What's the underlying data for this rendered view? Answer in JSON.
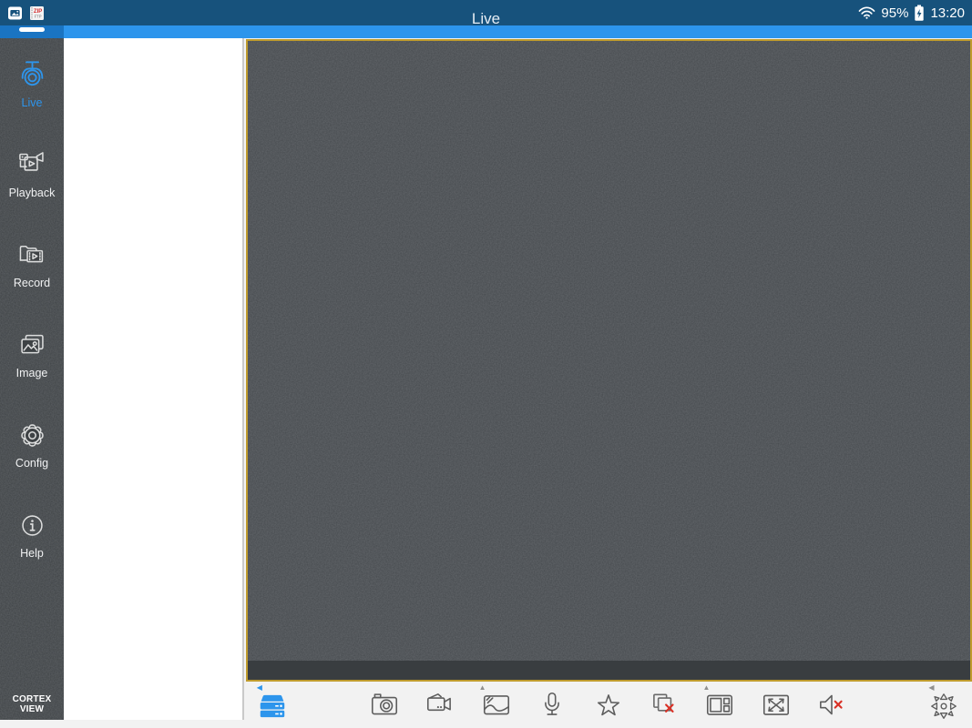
{
  "header": {
    "title": "Live"
  },
  "status_bar": {
    "battery_percent": "95%",
    "time": "13:20",
    "notification_zip_label": "ZIP",
    "notification_ftp_label": "FTP",
    "icons": [
      "screenshot-notification-icon",
      "zip-ftp-notification-icon",
      "wifi-icon",
      "battery-charging-icon"
    ]
  },
  "sidebar": {
    "brand": "CORTEX VIEW",
    "active_item": "Live",
    "items": [
      {
        "label": "Live",
        "icon": "ptz-camera-icon",
        "active": true
      },
      {
        "label": "Playback",
        "icon": "playback-film-icon",
        "active": false
      },
      {
        "label": "Record",
        "icon": "record-folder-icon",
        "active": false
      },
      {
        "label": "Image",
        "icon": "photos-icon",
        "active": false
      },
      {
        "label": "Config",
        "icon": "gear-icon",
        "active": false
      },
      {
        "label": "Help",
        "icon": "info-icon",
        "active": false
      }
    ]
  },
  "main": {
    "camera_list_panel": {
      "empty": true
    },
    "video_area": {
      "empty": true,
      "border_color": "#bf9b2d"
    }
  },
  "toolbar": {
    "icons": [
      "device-list-icon",
      "snapshot-icon",
      "record-icon",
      "image-icon",
      "microphone-icon",
      "favorite-star-icon",
      "close-all-icon",
      "split-view-icon",
      "fullscreen-icon",
      "mute-speaker-icon",
      "ptz-control-icon"
    ]
  },
  "colors": {
    "status_bar": "#17527c",
    "action_bar": "#2d95ec",
    "accent_blue": "#2d95ec",
    "video_border": "#bf9b2d",
    "sidebar_bg": "#3e4245",
    "video_bg": "#45494d",
    "toolbar_bg": "#f2f2f2",
    "alert_red": "#d93025"
  }
}
